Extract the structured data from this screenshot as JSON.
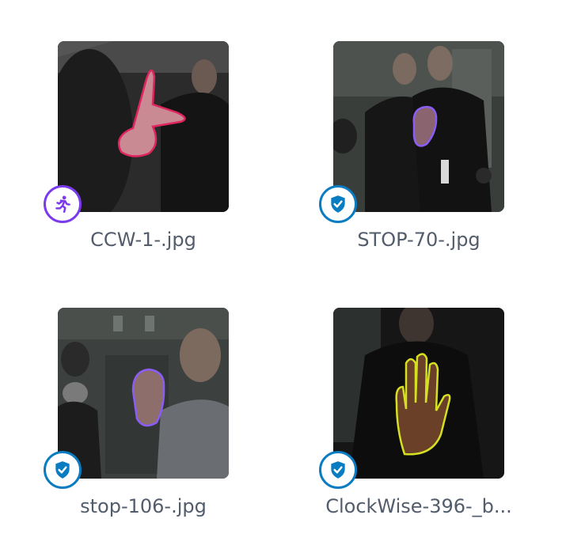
{
  "colors": {
    "running_badge": "#7c3aed",
    "shield_badge": "#0a7cc1",
    "filename_text": "#525c6b"
  },
  "images": [
    {
      "filename": "CCW-1-.jpg",
      "badge_icon": "running-person-icon",
      "annotation_color": "#e0245e"
    },
    {
      "filename": "STOP-70-.jpg",
      "badge_icon": "shield-check-icon",
      "annotation_color": "#8b5cf6"
    },
    {
      "filename": "stop-106-.jpg",
      "badge_icon": "shield-check-icon",
      "annotation_color": "#8b5cf6"
    },
    {
      "filename": "ClockWise-396-_b...",
      "badge_icon": "shield-check-icon",
      "annotation_color": "#d4e021"
    }
  ]
}
